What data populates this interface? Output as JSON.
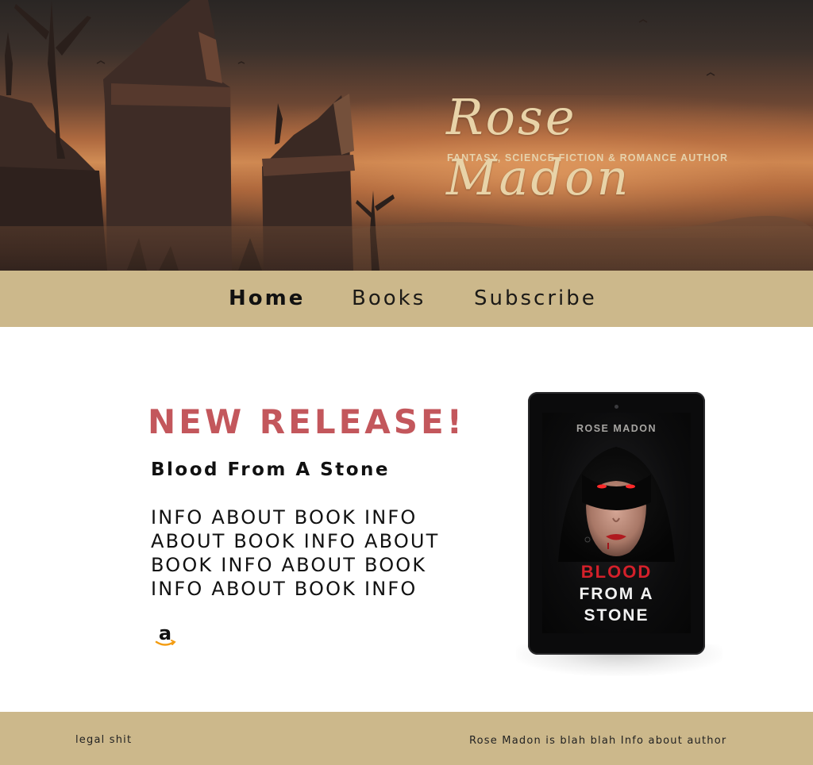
{
  "hero": {
    "author_name": "Rose Madon",
    "tagline": "FANTASY, SCIENCE FICTION & ROMANCE AUTHOR"
  },
  "nav": {
    "items": [
      {
        "label": "Home",
        "active": true
      },
      {
        "label": "Books",
        "active": false
      },
      {
        "label": "Subscribe",
        "active": false
      }
    ]
  },
  "release": {
    "headline": "NEW RELEASE!",
    "book_title": "Blood From A Stone",
    "info_lines": [
      "INFO ABOUT BOOK INFO",
      "ABOUT BOOK INFO ABOUT",
      "BOOK INFO ABOUT BOOK",
      "INFO ABOUT BOOK INFO"
    ],
    "buy_icon": "amazon-icon"
  },
  "cover": {
    "author": "ROSE MADON",
    "title_line1": "BLOOD",
    "title_line2": "FROM A",
    "title_line3": "STONE",
    "title_accent_color": "#d4202a"
  },
  "footer": {
    "left_text": "legal shit",
    "right_text": "Rose Madon is blah blah Info about author"
  },
  "colors": {
    "band": "#ccb88b",
    "headline": "#c3575c",
    "brand_text": "#e8d3a8"
  }
}
